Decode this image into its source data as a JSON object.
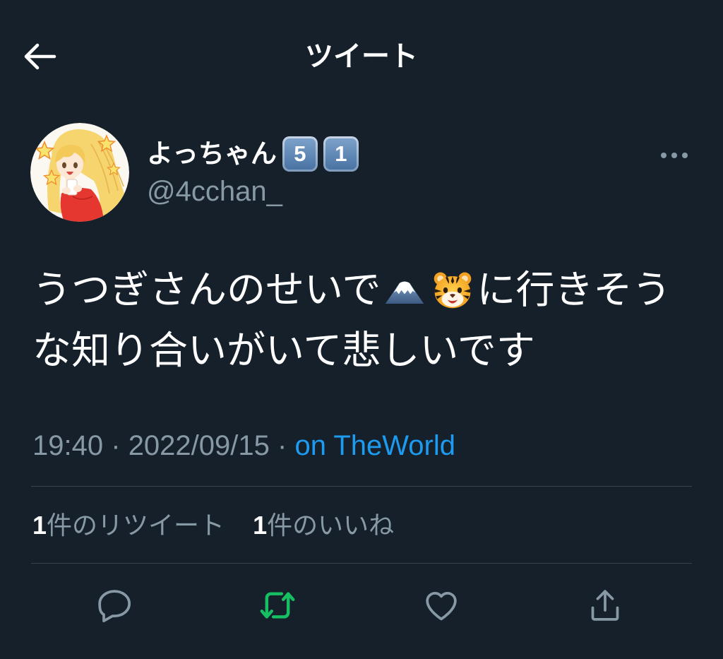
{
  "colors": {
    "background": "#15202b",
    "text_primary": "#ffffff",
    "text_secondary": "#8899a6",
    "link": "#1d9bf0",
    "retweet_active": "#17bf63",
    "divider": "#38444d"
  },
  "header": {
    "back_icon": "arrow-left-icon",
    "title": "ツイート"
  },
  "author": {
    "avatar": "avatar-illustration",
    "display_name": "よっちゃん",
    "name_badges": [
      "5",
      "1"
    ],
    "handle": "@4cchan_",
    "more_icon": "more-horizontal-icon"
  },
  "tweet": {
    "line1_text": "うつぎさんのせいで",
    "emoji": [
      "mount-fuji-emoji",
      "tiger-face-emoji"
    ],
    "line1_after_emoji": "に行きそう",
    "line2_text": "な知り合いがいて悲しいです"
  },
  "meta": {
    "time": "19:40",
    "separator": "·",
    "date": "2022/09/15",
    "source": "on TheWorld"
  },
  "stats": {
    "retweets": {
      "count": "1",
      "label": "件のリツイート"
    },
    "likes": {
      "count": "1",
      "label": "件のいいね"
    }
  },
  "actions": [
    {
      "icon": "reply-icon",
      "active": false
    },
    {
      "icon": "retweet-icon",
      "active": true
    },
    {
      "icon": "heart-icon",
      "active": false
    },
    {
      "icon": "share-icon",
      "active": false
    }
  ]
}
